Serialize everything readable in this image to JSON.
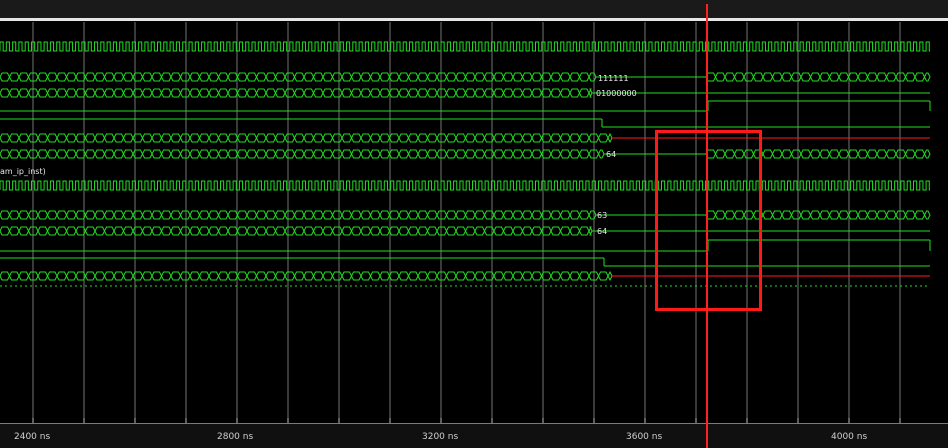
{
  "colors": {
    "wave": "#22dd22",
    "cursor": "#ff2020",
    "highlight": "#ff1a1a",
    "grid": "#8a8a8a",
    "background": "#000000"
  },
  "instance_label": "am_ip_inst)",
  "bus_labels": {
    "bus1": "111111",
    "bus2": "01000000",
    "bus3": "64",
    "bus4": "63",
    "bus5": "64"
  },
  "time_axis": {
    "ticks": [
      "2400 ns",
      "2800 ns",
      "3200 ns",
      "3600 ns",
      "4000 ns"
    ]
  }
}
